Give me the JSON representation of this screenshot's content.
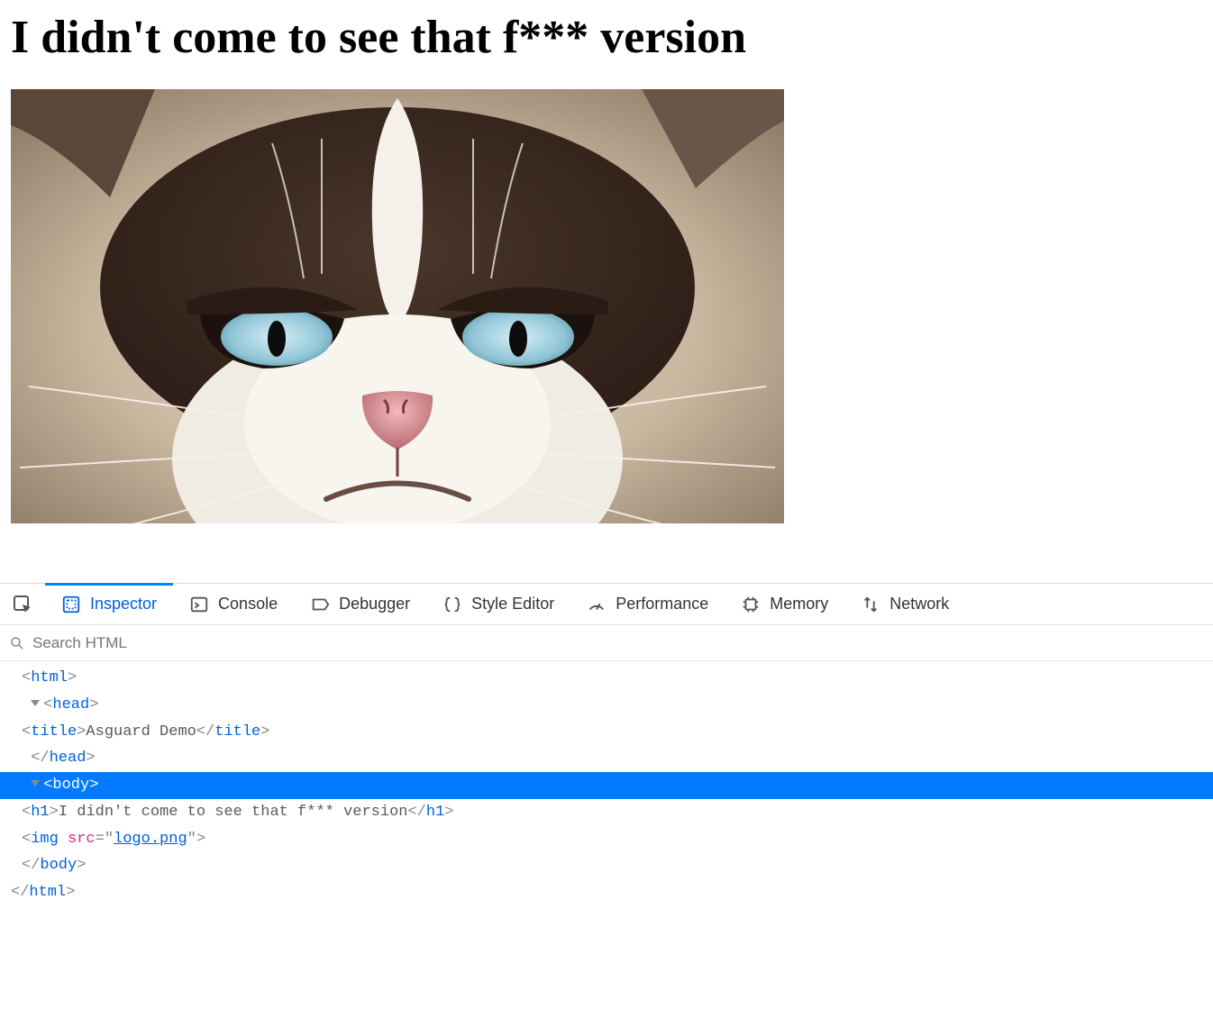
{
  "page": {
    "heading": "I didn't come to see that f*** version",
    "image_alt": "grumpy cat logo"
  },
  "devtools": {
    "tabs": {
      "inspector": "Inspector",
      "console": "Console",
      "debugger": "Debugger",
      "style_editor": "Style Editor",
      "performance": "Performance",
      "memory": "Memory",
      "network": "Network"
    },
    "search": {
      "placeholder": "Search HTML"
    },
    "tree": {
      "html_open": "html",
      "head_open": "head",
      "title_tag": "title",
      "title_text": "Asguard Demo",
      "head_close": "head",
      "body_open": "body",
      "h1_tag": "h1",
      "h1_text": "I didn't come to see that f*** version",
      "img_tag": "img",
      "img_attr": "src",
      "img_val": "logo.png",
      "body_close": "body",
      "html_close": "html"
    }
  }
}
